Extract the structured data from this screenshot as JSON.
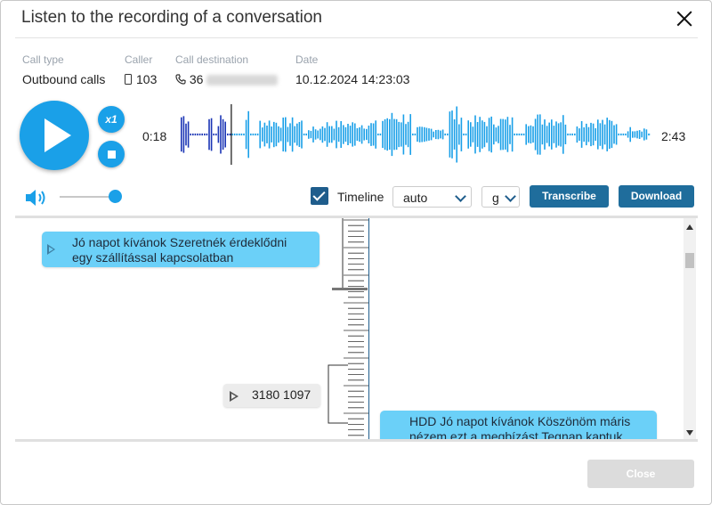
{
  "dialog": {
    "title": "Listen to the recording of a conversation",
    "close_button": "Close"
  },
  "call_info": {
    "call_type": {
      "label": "Call type",
      "value": "Outbound calls"
    },
    "caller": {
      "label": "Caller",
      "value": "103",
      "icon": "mobile-phone-icon"
    },
    "call_destination": {
      "label": "Call destination",
      "value_prefix": "36",
      "icon": "handset-icon"
    },
    "date": {
      "label": "Date",
      "value": "10.12.2024 14:23:03"
    }
  },
  "player": {
    "speed": "x1",
    "current_time": "0:18",
    "total_time": "2:43",
    "progress_fraction": 0.11,
    "volume_fraction": 1.0,
    "accent_color": "#1aa0e8"
  },
  "toolbar": {
    "timeline_label": "Timeline",
    "timeline_checked": true,
    "zoom_select": "auto",
    "unit_select": "g",
    "transcribe_label": "Transcribe",
    "download_label": "Download",
    "button_color": "#1f6d9c"
  },
  "transcript": {
    "messages": [
      {
        "side": "left",
        "text_line1": "Jó napot kívánok Szeretnék érdeklődni",
        "text_line2": "egy szállítással kapcsolatban"
      },
      {
        "side": "right",
        "text_line1": "HDD Jó napot kívánok Köszönöm máris",
        "text_line2": "nézem ezt a megbízást Tegnap kaptuk"
      }
    ],
    "silence_label": "3180 1097",
    "bubble_color": "#6bd0f8"
  }
}
